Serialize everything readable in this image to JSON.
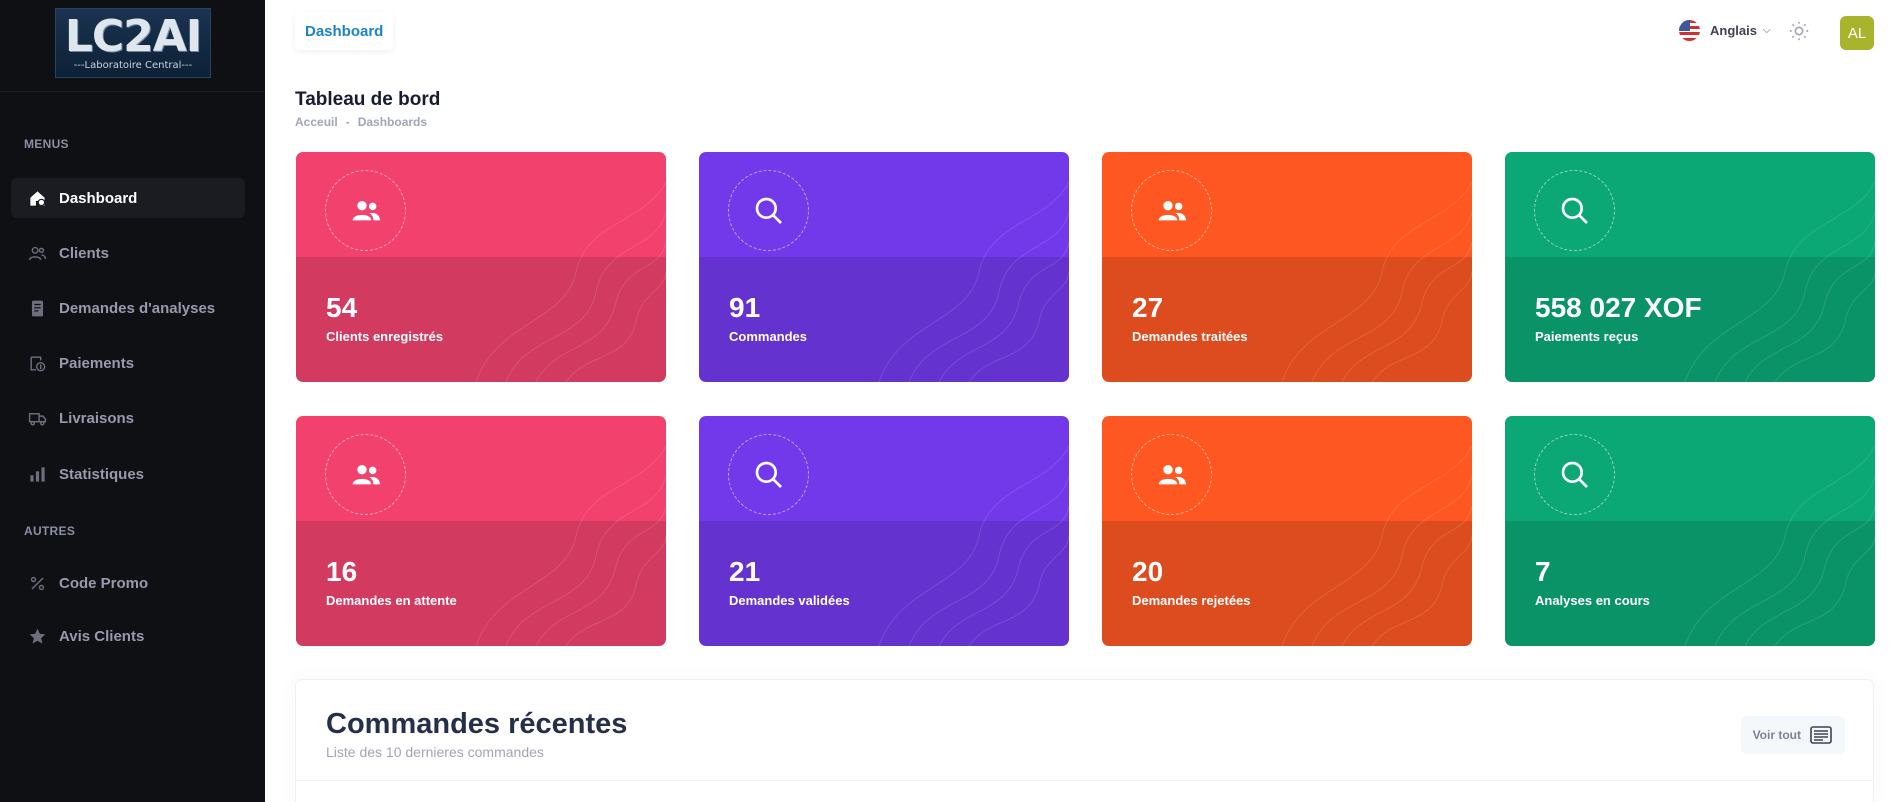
{
  "brand": {
    "logo_text": "LC2AI",
    "logo_sub": "---Laboratoire Central---"
  },
  "sidebar": {
    "headings": [
      "MENUS",
      "AUTRES"
    ],
    "items": [
      {
        "label": "Dashboard",
        "icon": "home-icon",
        "active": true
      },
      {
        "label": "Clients",
        "icon": "users-icon"
      },
      {
        "label": "Demandes d'analyses",
        "icon": "document-icon"
      },
      {
        "label": "Paiements",
        "icon": "payment-icon"
      },
      {
        "label": "Livraisons",
        "icon": "truck-icon"
      },
      {
        "label": "Statistiques",
        "icon": "bar-chart-icon"
      },
      {
        "label": "Code Promo",
        "icon": "percent-icon"
      },
      {
        "label": "Avis Clients",
        "icon": "star-icon"
      }
    ]
  },
  "topbar": {
    "tab": "Dashboard",
    "language": "Anglais",
    "language_flag": "us-flag-icon",
    "theme_icon": "sun-icon",
    "avatar_initials": "AL",
    "avatar_color": "#a8b52c"
  },
  "page": {
    "title": "Tableau de bord",
    "breadcrumb": [
      "Acceuil",
      "-",
      "Dashboards"
    ]
  },
  "cards": [
    {
      "value": "54",
      "label": "Clients enregistrés",
      "icon": "users-icon",
      "color": "#f1416c"
    },
    {
      "value": "91",
      "label": "Commandes",
      "icon": "search-icon",
      "color": "#7239ea"
    },
    {
      "value": "27",
      "label": "Demandes traitées",
      "icon": "users-icon",
      "color": "#ff5722"
    },
    {
      "value": "558 027 XOF",
      "label": "Paiements reçus",
      "icon": "search-icon",
      "color": "#0ba774"
    },
    {
      "value": "16",
      "label": "Demandes en attente",
      "icon": "users-icon",
      "color": "#f1416c"
    },
    {
      "value": "21",
      "label": "Demandes validées",
      "icon": "search-icon",
      "color": "#7239ea"
    },
    {
      "value": "20",
      "label": "Demandes rejetées",
      "icon": "users-icon",
      "color": "#ff5722"
    },
    {
      "value": "7",
      "label": "Analyses en cours",
      "icon": "search-icon",
      "color": "#0ba774"
    }
  ],
  "recent_orders": {
    "title": "Commandes récentes",
    "subtitle": "Liste des 10 dernieres commandes",
    "button_label": "Voir tout",
    "button_icon": "list-icon"
  }
}
